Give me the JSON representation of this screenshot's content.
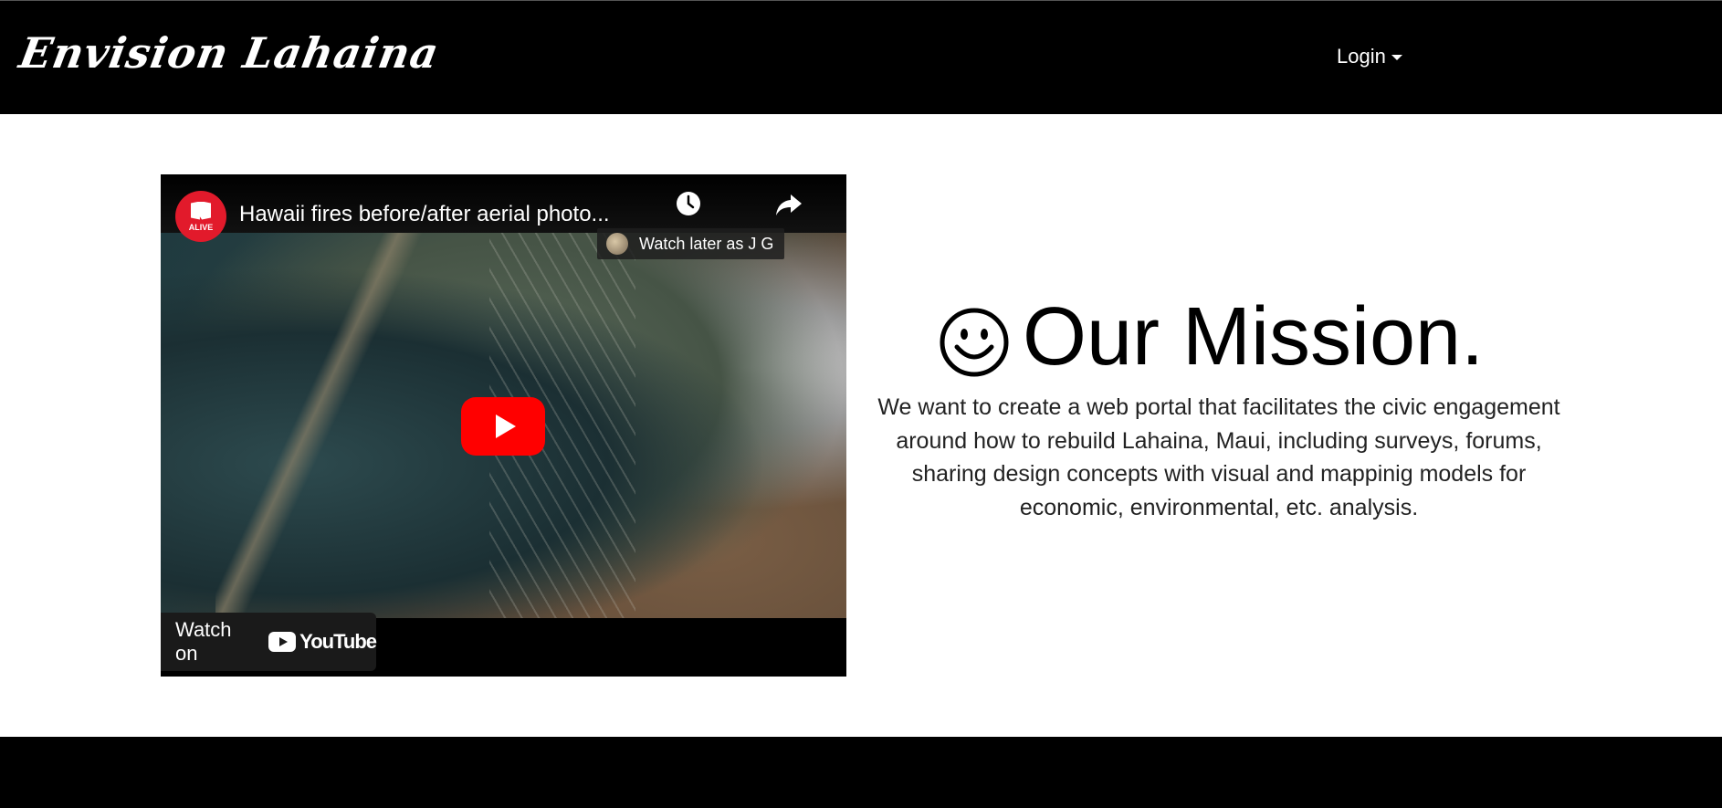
{
  "navbar": {
    "brand": "Envision Lahaina",
    "login_label": "Login"
  },
  "video": {
    "title": "Hawaii fires before/after aerial photo...",
    "channel_badge": "ALIVE",
    "watch_later": "Watch later as J G",
    "watch_on": "Watch on",
    "youtube_word": "YouTube",
    "icons": [
      "clock-icon",
      "share-icon",
      "play-icon",
      "youtube-logo-icon"
    ]
  },
  "mission": {
    "icon": "smiley-icon",
    "title": "Our Mission.",
    "text": "We want to create a web portal that facilitates the civic engagement around how to rebuild Lahaina, Maui, including surveys, forums, sharing design concepts with visual and mappinig models for economic, environmental, etc. analysis."
  },
  "colors": {
    "navbar_bg": "#000000",
    "youtube_red": "#ff0000",
    "channel_red": "#e21a2b"
  }
}
